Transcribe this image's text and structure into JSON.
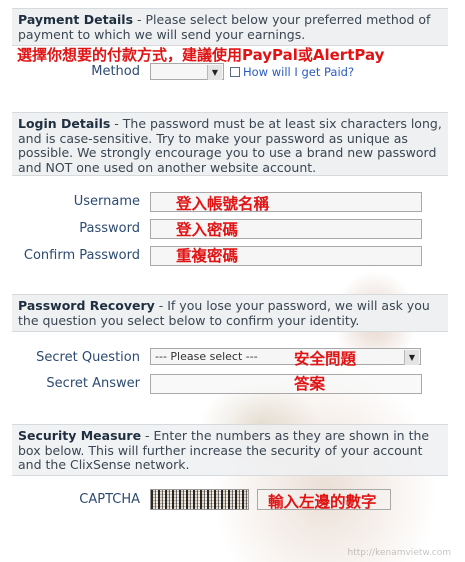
{
  "payment": {
    "heading": "Payment Details",
    "description": " - Please select below your preferred method of payment to which we will send your earnings.",
    "annotation": "選擇你想要的付款方式，建議使用PayPal或AlertPay",
    "method_label": "Method",
    "method_value": "",
    "help_link": "How will I get Paid?"
  },
  "login": {
    "heading": "Login Details",
    "description": " - The password must be at least six characters long, and is case-sensitive. Try to make your password as unique as possible. We strongly encourage you to use a brand new password and NOT one used on another website account.",
    "username_label": "Username",
    "username_note": "登入帳號名稱",
    "password_label": "Password",
    "password_note": "登入密碼",
    "confirm_label": "Confirm Password",
    "confirm_note": "重複密碼"
  },
  "recovery": {
    "heading": "Password Recovery",
    "description": " - If you lose your password, we will ask you the question you select below to confirm your identity.",
    "question_label": "Secret Question",
    "question_value": "--- Please select ---",
    "question_note": "安全問題",
    "answer_label": "Secret Answer",
    "answer_note": "答案"
  },
  "security": {
    "heading": "Security Measure",
    "description": " - Enter the numbers as they are shown in the box below. This will further increase the security of your account and the ClixSense network.",
    "captcha_label": "CAPTCHA",
    "captcha_note": "輸入左邊的數字"
  },
  "watermark": "http://kenamvietw.com"
}
